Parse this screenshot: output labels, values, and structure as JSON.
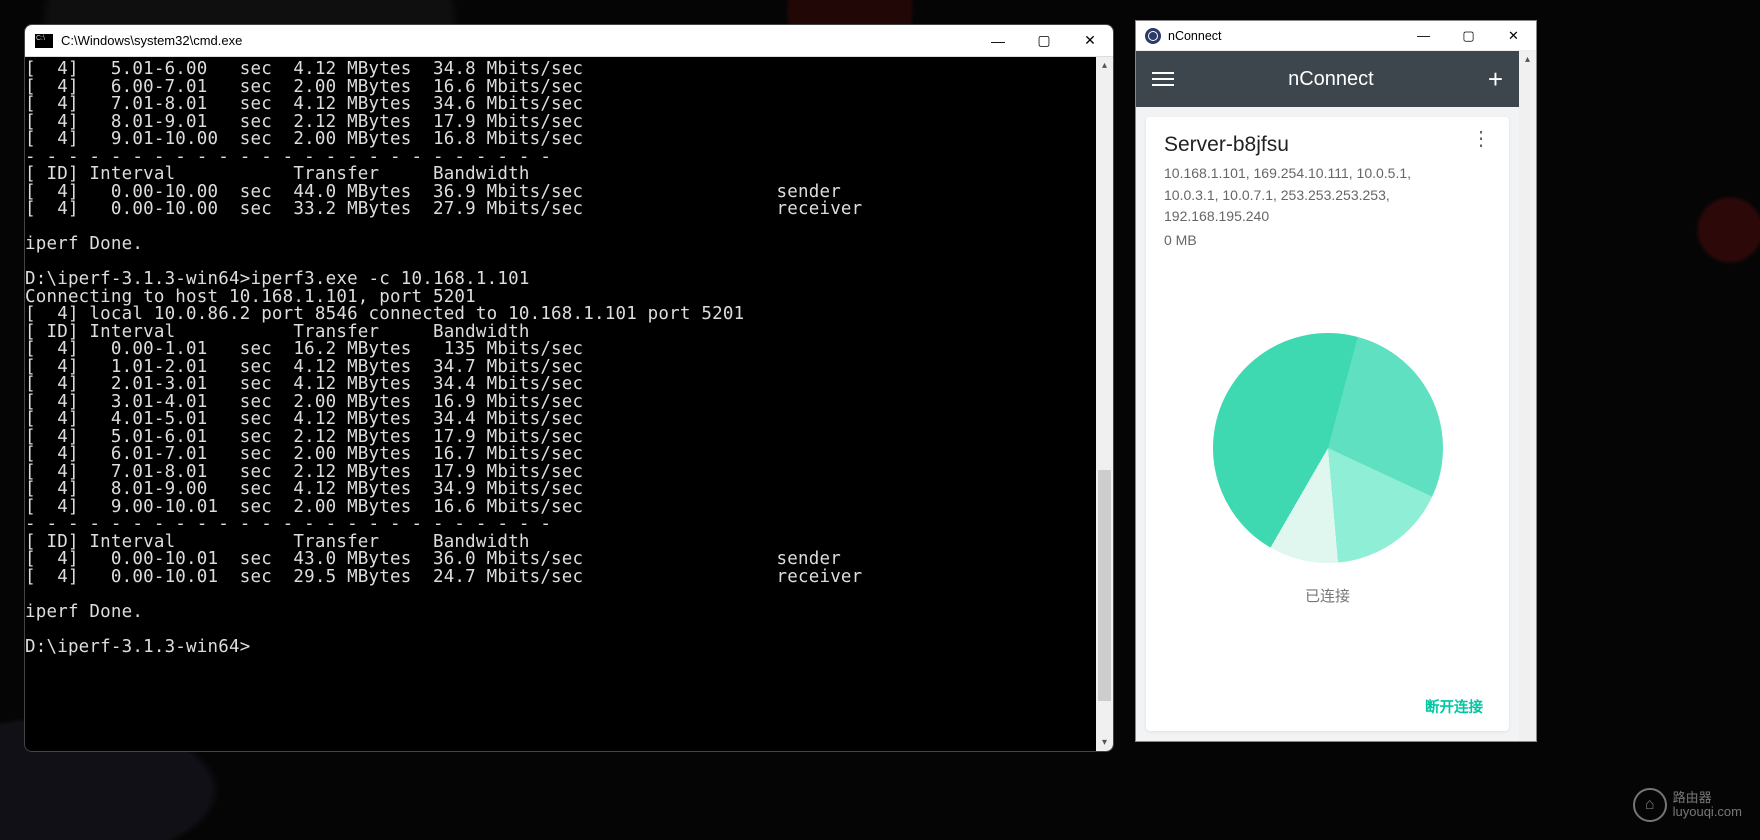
{
  "cmd": {
    "title": "C:\\Windows\\system32\\cmd.exe",
    "lines": [
      "[  4]   5.01-6.00   sec  4.12 MBytes  34.8 Mbits/sec",
      "[  4]   6.00-7.01   sec  2.00 MBytes  16.6 Mbits/sec",
      "[  4]   7.01-8.01   sec  4.12 MBytes  34.6 Mbits/sec",
      "[  4]   8.01-9.01   sec  2.12 MBytes  17.9 Mbits/sec",
      "[  4]   9.01-10.00  sec  2.00 MBytes  16.8 Mbits/sec",
      "- - - - - - - - - - - - - - - - - - - - - - - - -",
      "[ ID] Interval           Transfer     Bandwidth",
      "[  4]   0.00-10.00  sec  44.0 MBytes  36.9 Mbits/sec                  sender",
      "[  4]   0.00-10.00  sec  33.2 MBytes  27.9 Mbits/sec                  receiver",
      "",
      "iperf Done.",
      "",
      "D:\\iperf-3.1.3-win64>iperf3.exe -c 10.168.1.101",
      "Connecting to host 10.168.1.101, port 5201",
      "[  4] local 10.0.86.2 port 8546 connected to 10.168.1.101 port 5201",
      "[ ID] Interval           Transfer     Bandwidth",
      "[  4]   0.00-1.01   sec  16.2 MBytes   135 Mbits/sec",
      "[  4]   1.01-2.01   sec  4.12 MBytes  34.7 Mbits/sec",
      "[  4]   2.01-3.01   sec  4.12 MBytes  34.4 Mbits/sec",
      "[  4]   3.01-4.01   sec  2.00 MBytes  16.9 Mbits/sec",
      "[  4]   4.01-5.01   sec  4.12 MBytes  34.4 Mbits/sec",
      "[  4]   5.01-6.01   sec  2.12 MBytes  17.9 Mbits/sec",
      "[  4]   6.01-7.01   sec  2.00 MBytes  16.7 Mbits/sec",
      "[  4]   7.01-8.01   sec  2.12 MBytes  17.9 Mbits/sec",
      "[  4]   8.01-9.00   sec  4.12 MBytes  34.9 Mbits/sec",
      "[  4]   9.00-10.01  sec  2.00 MBytes  16.6 Mbits/sec",
      "- - - - - - - - - - - - - - - - - - - - - - - - -",
      "[ ID] Interval           Transfer     Bandwidth",
      "[  4]   0.00-10.01  sec  43.0 MBytes  36.0 Mbits/sec                  sender",
      "[  4]   0.00-10.01  sec  29.5 MBytes  24.7 Mbits/sec                  receiver",
      "",
      "iperf Done.",
      "",
      "D:\\iperf-3.1.3-win64>"
    ]
  },
  "nc": {
    "win_title": "nConnect",
    "header_title": "nConnect",
    "server_name": "Server-b8jfsu",
    "ips_line1": "10.168.1.101, 169.254.10.111, 10.0.5.1,",
    "ips_line2": "10.0.3.1, 10.0.7.1, 253.253.253.253,",
    "ips_line3": "192.168.195.240",
    "data_usage": "0 MB",
    "status": "已连接",
    "disconnect": "断开连接"
  },
  "watermark": {
    "line1": "路由器",
    "line2": "luyouqi.com"
  }
}
